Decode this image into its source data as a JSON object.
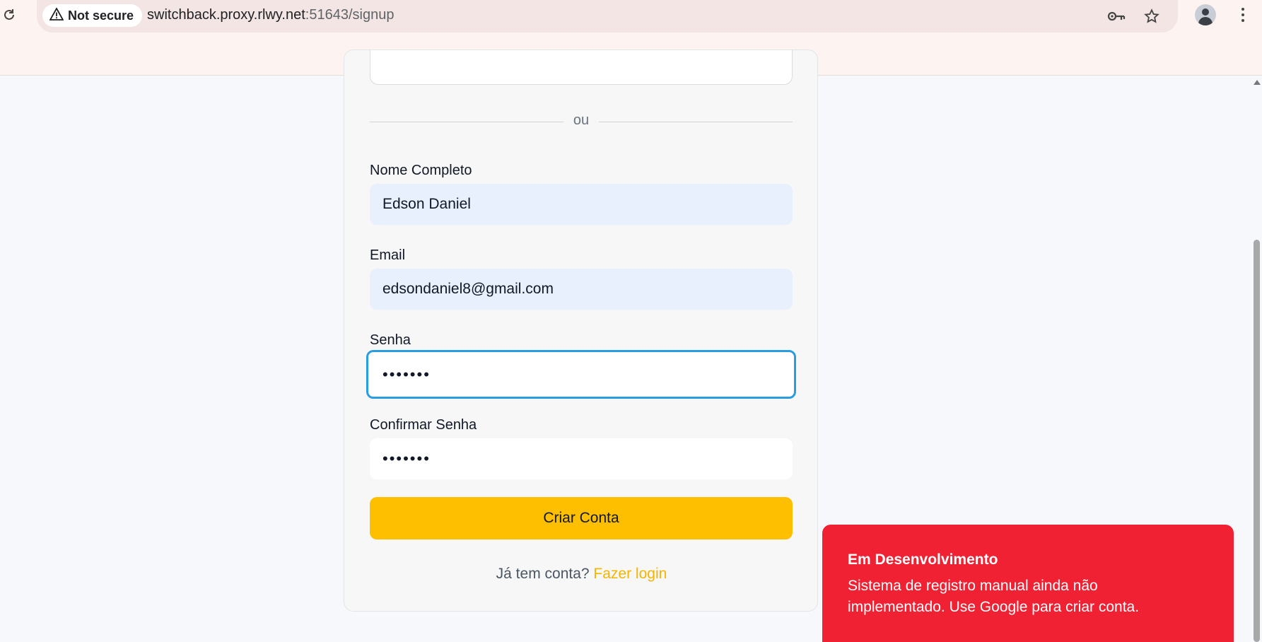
{
  "browser": {
    "security_label": "Not secure",
    "url_host": "switchback.proxy.rlwy.net",
    "url_rest": ":51643/signup",
    "icons": [
      "reload-icon",
      "warning-icon",
      "key-icon",
      "star-icon",
      "avatar",
      "menu-icon"
    ]
  },
  "form": {
    "divider_text": "ou",
    "name_label": "Nome Completo",
    "name_value": "Edson Daniel",
    "email_label": "Email",
    "email_value": "edsondaniel8@gmail.com",
    "password_label": "Senha",
    "password_value": "•••••••",
    "confirm_label": "Confirmar Senha",
    "confirm_value": "•••••••",
    "submit_label": "Criar Conta",
    "login_prompt": "Já tem conta?",
    "login_link": "Fazer login"
  },
  "toast": {
    "title": "Em Desenvolvimento",
    "message": "Sistema de registro manual ainda não implementado. Use Google para criar conta."
  },
  "colors": {
    "accent": "#fdbf00",
    "focus": "#2a9de0",
    "toast_bg": "#f02133",
    "link": "#f5b400"
  }
}
